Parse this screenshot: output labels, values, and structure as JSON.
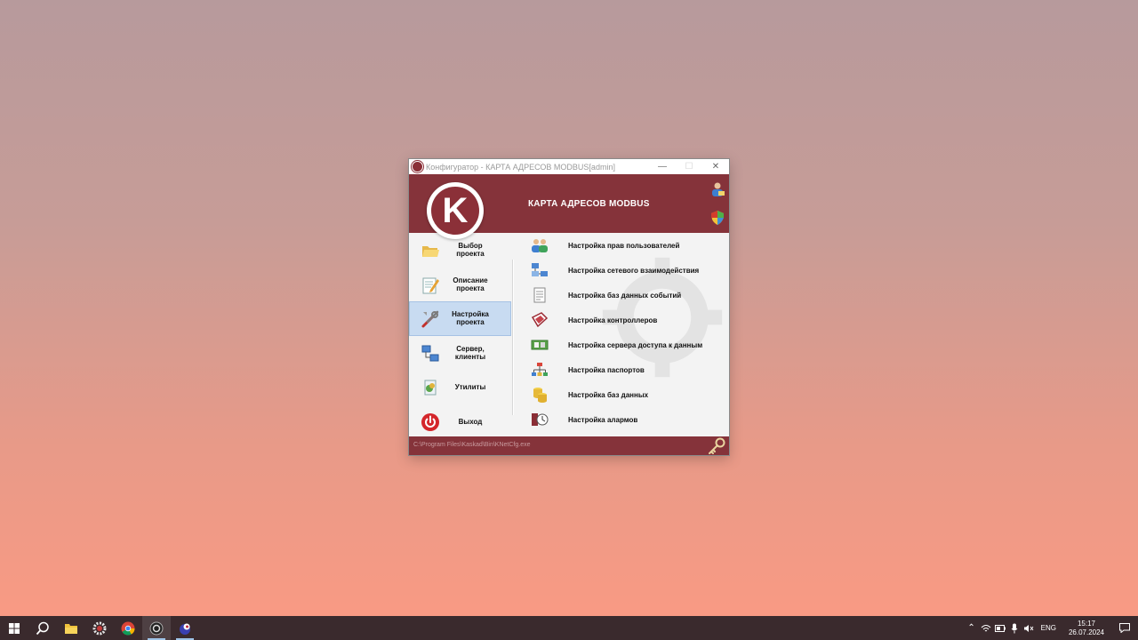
{
  "window": {
    "title": "Конфигуратор - КАРТА АДРЕСОВ MODBUS[admin]",
    "minimize_glyph": "—",
    "maximize_glyph": "☐",
    "close_glyph": "✕"
  },
  "header": {
    "title": "КАРТА АДРЕСОВ MODBUS",
    "logo_letter": "K",
    "brand_color": "#85333a"
  },
  "sidebar": {
    "items": [
      {
        "label": "Выбор проекта",
        "icon": "folder-icon"
      },
      {
        "label": "Описание проекта",
        "icon": "notepad-icon"
      },
      {
        "label": "Настройка проекта",
        "icon": "tools-icon",
        "active": true
      },
      {
        "label": "Сервер, клиенты",
        "icon": "network-icon"
      },
      {
        "label": "Утилиты",
        "icon": "utilities-icon"
      },
      {
        "label": "Выход",
        "icon": "power-icon"
      }
    ]
  },
  "menu": {
    "items": [
      {
        "label": "Настройка прав пользователей",
        "icon": "users-icon"
      },
      {
        "label": "Настройка сетевого взаимодействия",
        "icon": "network-computers-icon"
      },
      {
        "label": "Настройка баз данных событий",
        "icon": "document-icon"
      },
      {
        "label": "Настройка контроллеров",
        "icon": "controller-icon"
      },
      {
        "label": "Настройка сервера доступа к данным",
        "icon": "server-board-icon"
      },
      {
        "label": "Настройка паспортов",
        "icon": "hierarchy-icon"
      },
      {
        "label": "Настройка баз данных",
        "icon": "database-icon"
      },
      {
        "label": "Настройка алармов",
        "icon": "alarm-icon"
      }
    ]
  },
  "footer": {
    "path": "C:\\Program Files\\Kaskad\\Bin\\KNetCfg.exe"
  },
  "taskbar": {
    "language": "ENG",
    "time": "15:17",
    "date": "26.07.2024"
  }
}
